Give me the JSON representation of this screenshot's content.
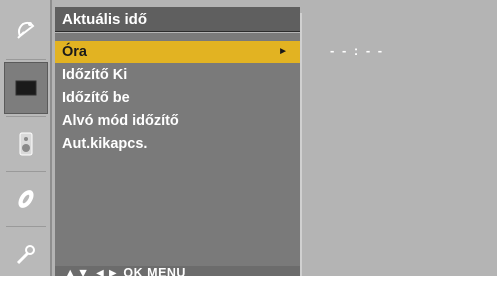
{
  "menu": {
    "title": "Aktuális idő",
    "items": [
      {
        "label": "Óra",
        "selected": true,
        "arrow": "►"
      },
      {
        "label": "Időzítő Ki",
        "selected": false
      },
      {
        "label": "Időzítő be",
        "selected": false
      },
      {
        "label": "Alvó mód időzítő",
        "selected": false
      },
      {
        "label": "Aut.kikapcs.",
        "selected": false
      }
    ]
  },
  "nav_hint": "▲▼ ◄► OK MENU",
  "value_panel": {
    "time": "- - : - -"
  },
  "sidebar": {
    "icons": [
      {
        "name": "satellite-dish-icon",
        "active": false
      },
      {
        "name": "screen-icon",
        "active": true
      },
      {
        "name": "speaker-icon",
        "active": false
      },
      {
        "name": "disc-icon",
        "active": false
      },
      {
        "name": "wrench-icon",
        "active": false
      }
    ]
  },
  "colors": {
    "background": "#b4b4b4",
    "menu_panel": "#7a7a7a",
    "highlight": "#e2b322",
    "title_bar": "#5f5f5f"
  }
}
